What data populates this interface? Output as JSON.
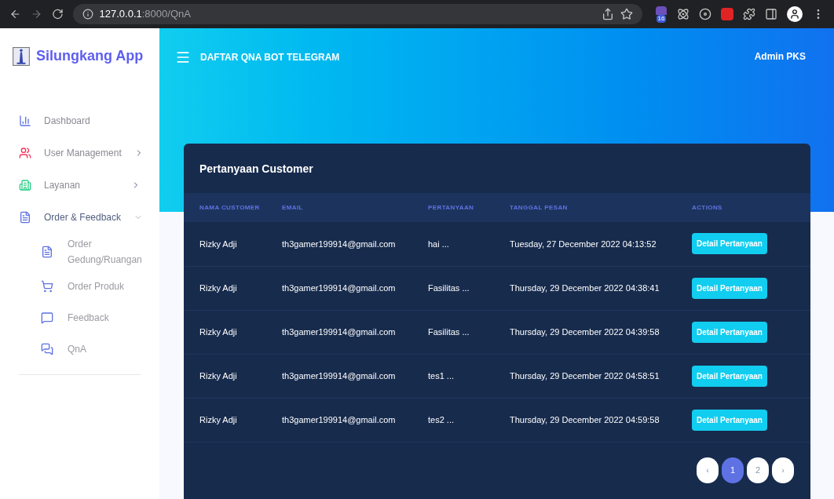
{
  "browser": {
    "url_host": "127.0.0.1",
    "url_path": ":8000/QnA",
    "extension_badge": "16"
  },
  "sidebar": {
    "brand": "Silungkang App",
    "items": [
      {
        "label": "Dashboard",
        "expandable": false,
        "expanded": false
      },
      {
        "label": "User Management",
        "expandable": true,
        "expanded": false
      },
      {
        "label": "Layanan",
        "expandable": true,
        "expanded": false
      },
      {
        "label": "Order & Feedback",
        "expandable": true,
        "expanded": true,
        "children": [
          {
            "label": "Order Gedung/Ruangan"
          },
          {
            "label": "Order Produk"
          },
          {
            "label": "Feedback"
          },
          {
            "label": "QnA"
          }
        ]
      }
    ]
  },
  "header": {
    "title": "DAFTAR QNA BOT TELEGRAM",
    "user": "Admin PKS"
  },
  "card": {
    "title": "Pertanyaan Customer",
    "table": {
      "columns": [
        "NAMA CUSTOMER",
        "EMAIL",
        "PERTANYAAN",
        "TANGGAL PESAN",
        "ACTIONS"
      ],
      "rows": [
        {
          "name": "Rizky Adji",
          "email": "th3gamer199914@gmail.com",
          "question": "hai ...",
          "date": "Tuesday, 27 December 2022 04:13:52",
          "action": "Detail Pertanyaan"
        },
        {
          "name": "Rizky Adji",
          "email": "th3gamer199914@gmail.com",
          "question": "Fasilitas ...",
          "date": "Thursday, 29 December 2022 04:38:41",
          "action": "Detail Pertanyaan"
        },
        {
          "name": "Rizky Adji",
          "email": "th3gamer199914@gmail.com",
          "question": "Fasilitas ...",
          "date": "Thursday, 29 December 2022 04:39:58",
          "action": "Detail Pertanyaan"
        },
        {
          "name": "Rizky Adji",
          "email": "th3gamer199914@gmail.com",
          "question": "tes1 ...",
          "date": "Thursday, 29 December 2022 04:58:51",
          "action": "Detail Pertanyaan"
        },
        {
          "name": "Rizky Adji",
          "email": "th3gamer199914@gmail.com",
          "question": "tes2 ...",
          "date": "Thursday, 29 December 2022 04:59:58",
          "action": "Detail Pertanyaan"
        }
      ]
    },
    "pagination": [
      {
        "label": "‹",
        "selected": false
      },
      {
        "label": "1",
        "selected": true
      },
      {
        "label": "2",
        "selected": false
      },
      {
        "label": "›",
        "selected": false
      }
    ]
  }
}
